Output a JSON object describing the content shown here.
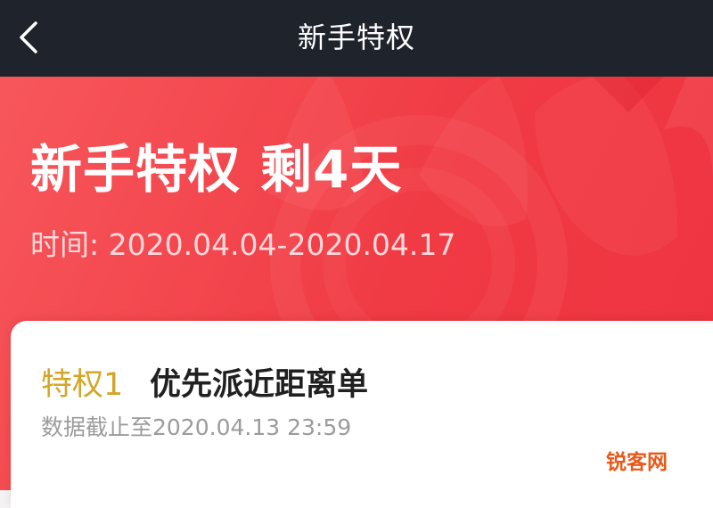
{
  "nav": {
    "back_icon": "chevron-left-icon",
    "title": "新手特权"
  },
  "hero": {
    "title": "新手特权",
    "remaining": "剩4天",
    "period": "时间: 2020.04.04-2020.04.17"
  },
  "privileges": [
    {
      "tag": "特权1",
      "name": "优先派近距离单",
      "deadline": "数据截止至2020.04.13 23:59"
    }
  ],
  "watermark": "锐客网",
  "colors": {
    "nav_bg": "#1f232b",
    "hero_red": "#f03a44",
    "tag_gold": "#d3a62a",
    "watermark_orange": "#e85a1a"
  }
}
